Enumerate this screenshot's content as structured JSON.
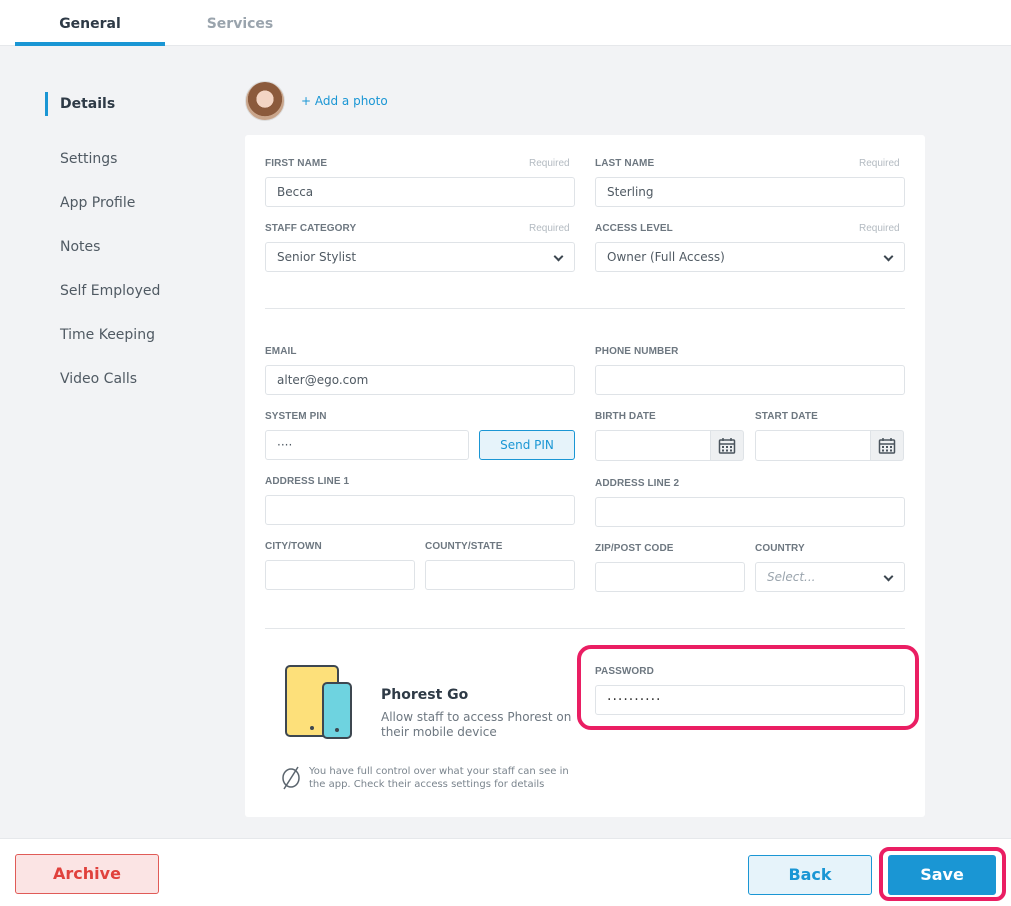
{
  "tabs": [
    {
      "label": "General"
    },
    {
      "label": "Services"
    }
  ],
  "sidebar": {
    "items": [
      {
        "label": "Details"
      },
      {
        "label": "Settings"
      },
      {
        "label": "App Profile"
      },
      {
        "label": "Notes"
      },
      {
        "label": "Self Employed"
      },
      {
        "label": "Time Keeping"
      },
      {
        "label": "Video Calls"
      }
    ]
  },
  "photo": {
    "add_label": "+ Add a photo"
  },
  "form": {
    "required_label": "Required",
    "first_name": {
      "label": "FIRST NAME",
      "value": "Becca"
    },
    "last_name": {
      "label": "LAST NAME",
      "value": "Sterling"
    },
    "staff_category": {
      "label": "STAFF CATEGORY",
      "value": "Senior Stylist"
    },
    "access_level": {
      "label": "ACCESS LEVEL",
      "value": "Owner (Full Access)"
    },
    "email": {
      "label": "EMAIL",
      "value": "alter@ego.com"
    },
    "phone": {
      "label": "PHONE NUMBER",
      "value": ""
    },
    "system_pin": {
      "label": "SYSTEM PIN",
      "value": "····"
    },
    "send_pin_label": "Send PIN",
    "birth_date": {
      "label": "BIRTH DATE",
      "value": ""
    },
    "start_date": {
      "label": "START DATE",
      "value": ""
    },
    "address1": {
      "label": "ADDRESS LINE 1",
      "value": ""
    },
    "address2": {
      "label": "ADDRESS LINE 2",
      "value": ""
    },
    "city": {
      "label": "CITY/TOWN",
      "value": ""
    },
    "county": {
      "label": "COUNTY/STATE",
      "value": ""
    },
    "zip": {
      "label": "ZIP/POST CODE",
      "value": ""
    },
    "country": {
      "label": "COUNTRY",
      "placeholder": "Select..."
    },
    "password": {
      "label": "PASSWORD",
      "value": "··········"
    }
  },
  "phorest_go": {
    "title": "Phorest Go",
    "description": "Allow staff to access Phorest on their mobile device",
    "notice": "You have full control over what your staff can see in the app. Check their access settings for details"
  },
  "footer": {
    "archive_label": "Archive",
    "back_label": "Back",
    "save_label": "Save"
  },
  "colors": {
    "accent": "#1a96d4",
    "highlight": "#ea1e63",
    "danger": "#e0413c"
  }
}
